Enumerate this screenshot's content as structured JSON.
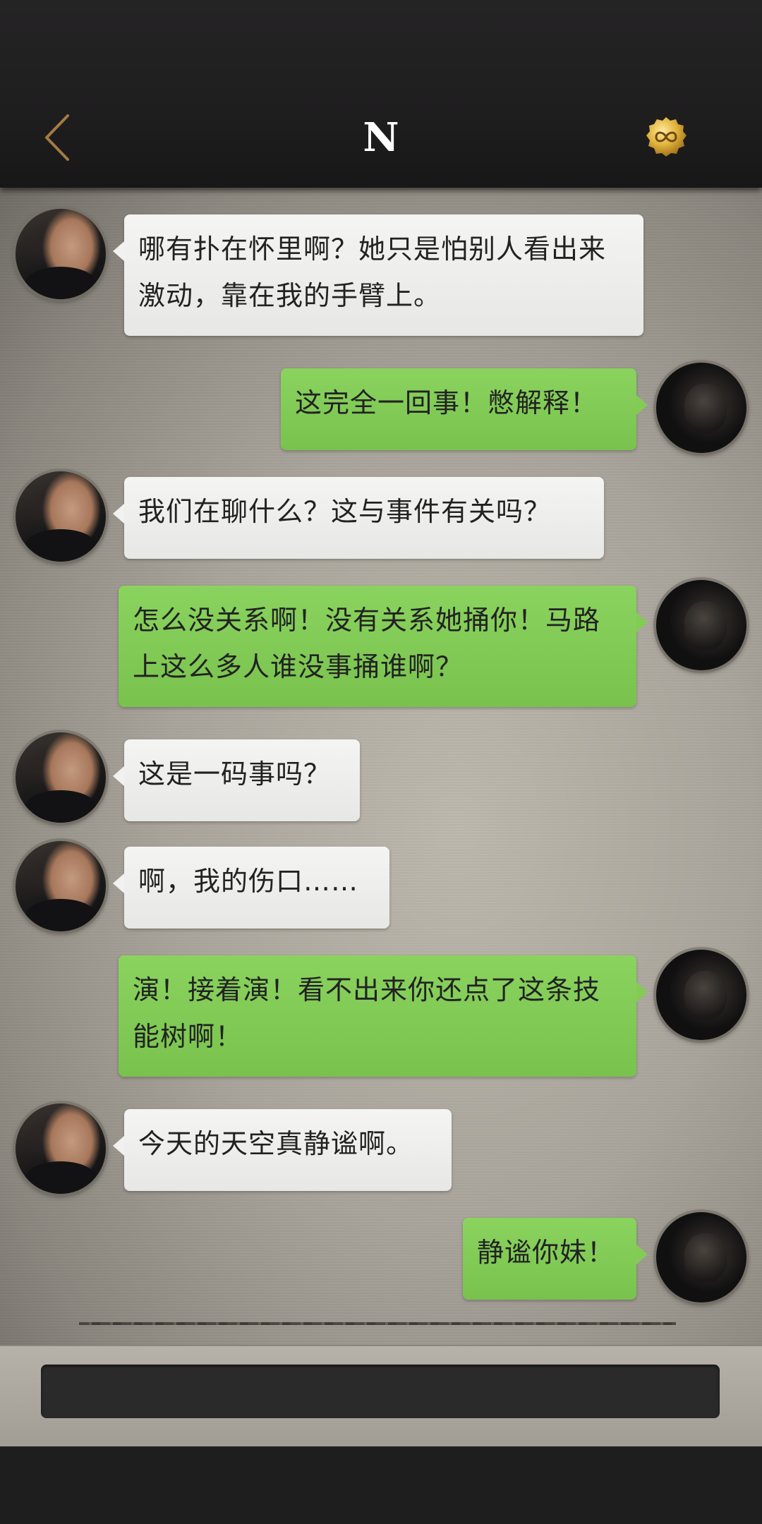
{
  "header": {
    "title": "N",
    "back_icon": "chevron-left-icon",
    "coin_icon": "infinity-coin-icon",
    "colors": {
      "back": "#a27b45",
      "coin": "#e2b23b"
    }
  },
  "messages": [
    {
      "sender": "other",
      "text": "哪有扑在怀里啊？她只是怕别人看出来激动，靠在我的手臂上。"
    },
    {
      "sender": "self",
      "text": "这完全一回事！憋解释！"
    },
    {
      "sender": "other",
      "text": "我们在聊什么？这与事件有关吗？"
    },
    {
      "sender": "self",
      "text": "怎么没关系啊！没有关系她捅你！马路上这么多人谁没事捅谁啊？"
    },
    {
      "sender": "other",
      "text": "这是一码事吗？"
    },
    {
      "sender": "other",
      "text": "啊，我的伤口……"
    },
    {
      "sender": "self",
      "text": "演！接着演！看不出来你还点了这条技能树啊！"
    },
    {
      "sender": "other",
      "text": "今天的天空真静谧啊。"
    },
    {
      "sender": "self",
      "text": "静谧你妹！"
    }
  ],
  "colors": {
    "bubble_other": "#efefed",
    "bubble_self": "#82cc56",
    "text": "#222222"
  }
}
